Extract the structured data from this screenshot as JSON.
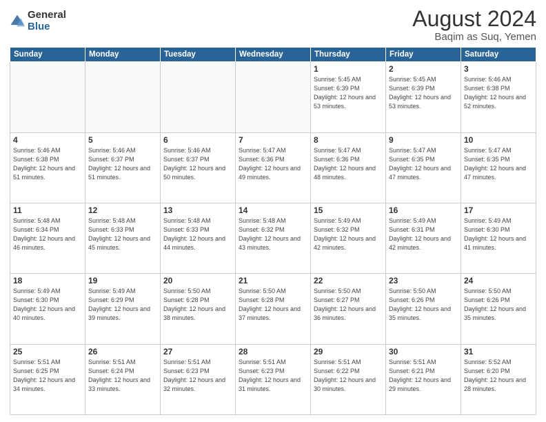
{
  "logo": {
    "general": "General",
    "blue": "Blue"
  },
  "title": "August 2024",
  "subtitle": "Baqim as Suq, Yemen",
  "days_of_week": [
    "Sunday",
    "Monday",
    "Tuesday",
    "Wednesday",
    "Thursday",
    "Friday",
    "Saturday"
  ],
  "weeks": [
    [
      {
        "day": "",
        "sunrise": "",
        "sunset": "",
        "daylight": ""
      },
      {
        "day": "",
        "sunrise": "",
        "sunset": "",
        "daylight": ""
      },
      {
        "day": "",
        "sunrise": "",
        "sunset": "",
        "daylight": ""
      },
      {
        "day": "",
        "sunrise": "",
        "sunset": "",
        "daylight": ""
      },
      {
        "day": "1",
        "sunrise": "5:45 AM",
        "sunset": "6:39 PM",
        "daylight": "12 hours and 53 minutes."
      },
      {
        "day": "2",
        "sunrise": "5:45 AM",
        "sunset": "6:39 PM",
        "daylight": "12 hours and 53 minutes."
      },
      {
        "day": "3",
        "sunrise": "5:46 AM",
        "sunset": "6:38 PM",
        "daylight": "12 hours and 52 minutes."
      }
    ],
    [
      {
        "day": "4",
        "sunrise": "5:46 AM",
        "sunset": "6:38 PM",
        "daylight": "12 hours and 51 minutes."
      },
      {
        "day": "5",
        "sunrise": "5:46 AM",
        "sunset": "6:37 PM",
        "daylight": "12 hours and 51 minutes."
      },
      {
        "day": "6",
        "sunrise": "5:46 AM",
        "sunset": "6:37 PM",
        "daylight": "12 hours and 50 minutes."
      },
      {
        "day": "7",
        "sunrise": "5:47 AM",
        "sunset": "6:36 PM",
        "daylight": "12 hours and 49 minutes."
      },
      {
        "day": "8",
        "sunrise": "5:47 AM",
        "sunset": "6:36 PM",
        "daylight": "12 hours and 48 minutes."
      },
      {
        "day": "9",
        "sunrise": "5:47 AM",
        "sunset": "6:35 PM",
        "daylight": "12 hours and 47 minutes."
      },
      {
        "day": "10",
        "sunrise": "5:47 AM",
        "sunset": "6:35 PM",
        "daylight": "12 hours and 47 minutes."
      }
    ],
    [
      {
        "day": "11",
        "sunrise": "5:48 AM",
        "sunset": "6:34 PM",
        "daylight": "12 hours and 46 minutes."
      },
      {
        "day": "12",
        "sunrise": "5:48 AM",
        "sunset": "6:33 PM",
        "daylight": "12 hours and 45 minutes."
      },
      {
        "day": "13",
        "sunrise": "5:48 AM",
        "sunset": "6:33 PM",
        "daylight": "12 hours and 44 minutes."
      },
      {
        "day": "14",
        "sunrise": "5:48 AM",
        "sunset": "6:32 PM",
        "daylight": "12 hours and 43 minutes."
      },
      {
        "day": "15",
        "sunrise": "5:49 AM",
        "sunset": "6:32 PM",
        "daylight": "12 hours and 42 minutes."
      },
      {
        "day": "16",
        "sunrise": "5:49 AM",
        "sunset": "6:31 PM",
        "daylight": "12 hours and 42 minutes."
      },
      {
        "day": "17",
        "sunrise": "5:49 AM",
        "sunset": "6:30 PM",
        "daylight": "12 hours and 41 minutes."
      }
    ],
    [
      {
        "day": "18",
        "sunrise": "5:49 AM",
        "sunset": "6:30 PM",
        "daylight": "12 hours and 40 minutes."
      },
      {
        "day": "19",
        "sunrise": "5:49 AM",
        "sunset": "6:29 PM",
        "daylight": "12 hours and 39 minutes."
      },
      {
        "day": "20",
        "sunrise": "5:50 AM",
        "sunset": "6:28 PM",
        "daylight": "12 hours and 38 minutes."
      },
      {
        "day": "21",
        "sunrise": "5:50 AM",
        "sunset": "6:28 PM",
        "daylight": "12 hours and 37 minutes."
      },
      {
        "day": "22",
        "sunrise": "5:50 AM",
        "sunset": "6:27 PM",
        "daylight": "12 hours and 36 minutes."
      },
      {
        "day": "23",
        "sunrise": "5:50 AM",
        "sunset": "6:26 PM",
        "daylight": "12 hours and 35 minutes."
      },
      {
        "day": "24",
        "sunrise": "5:50 AM",
        "sunset": "6:26 PM",
        "daylight": "12 hours and 35 minutes."
      }
    ],
    [
      {
        "day": "25",
        "sunrise": "5:51 AM",
        "sunset": "6:25 PM",
        "daylight": "12 hours and 34 minutes."
      },
      {
        "day": "26",
        "sunrise": "5:51 AM",
        "sunset": "6:24 PM",
        "daylight": "12 hours and 33 minutes."
      },
      {
        "day": "27",
        "sunrise": "5:51 AM",
        "sunset": "6:23 PM",
        "daylight": "12 hours and 32 minutes."
      },
      {
        "day": "28",
        "sunrise": "5:51 AM",
        "sunset": "6:23 PM",
        "daylight": "12 hours and 31 minutes."
      },
      {
        "day": "29",
        "sunrise": "5:51 AM",
        "sunset": "6:22 PM",
        "daylight": "12 hours and 30 minutes."
      },
      {
        "day": "30",
        "sunrise": "5:51 AM",
        "sunset": "6:21 PM",
        "daylight": "12 hours and 29 minutes."
      },
      {
        "day": "31",
        "sunrise": "5:52 AM",
        "sunset": "6:20 PM",
        "daylight": "12 hours and 28 minutes."
      }
    ]
  ]
}
